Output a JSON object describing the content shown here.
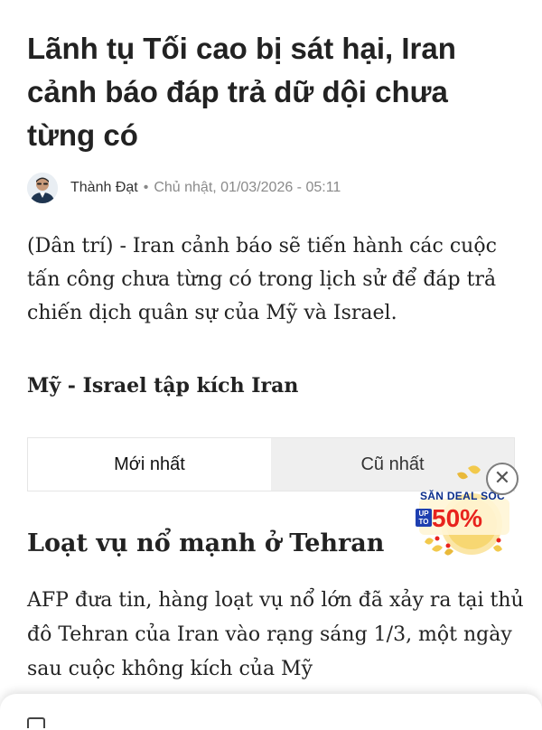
{
  "article": {
    "headline": "Lãnh tụ Tối cao bị sát hại, Iran cảnh báo đáp trả dữ dội chưa từng có",
    "byline": {
      "author": "Thành Đạt",
      "separator": "•",
      "date": "Chủ nhật, 01/03/2026 - 05:11"
    },
    "lead": "(Dân trí) - Iran cảnh báo sẽ tiến hành các cuộc tấn công chưa từng có trong lịch sử để đáp trả chiến dịch quân sự của Mỹ và Israel.",
    "live_section_title": "Mỹ - Israel tập kích Iran",
    "sort_tabs": {
      "newest": "Mới nhất",
      "oldest": "Cũ nhất",
      "active": "newest"
    },
    "sub_heading": "Loạt vụ nổ mạnh ở Tehran",
    "body": "AFP đưa tin, hàng loạt vụ nổ lớn đã xảy ra tại thủ đô Tehran của Iran vào rạng sáng 1/3, một ngày sau cuộc không kích của Mỹ"
  },
  "promo": {
    "title": "SĂN DEAL SỐC",
    "prefix": "UP TO",
    "discount": "50%",
    "close_glyph": "✕",
    "icons": [
      "close-icon",
      "gift-icon"
    ]
  },
  "colors": {
    "text": "#222222",
    "muted": "#8a8a8a",
    "tab_inactive_bg": "#efefef",
    "promo_red": "#e8231d",
    "promo_blue": "#0b2e8c",
    "promo_gold": "#f2c94c"
  }
}
